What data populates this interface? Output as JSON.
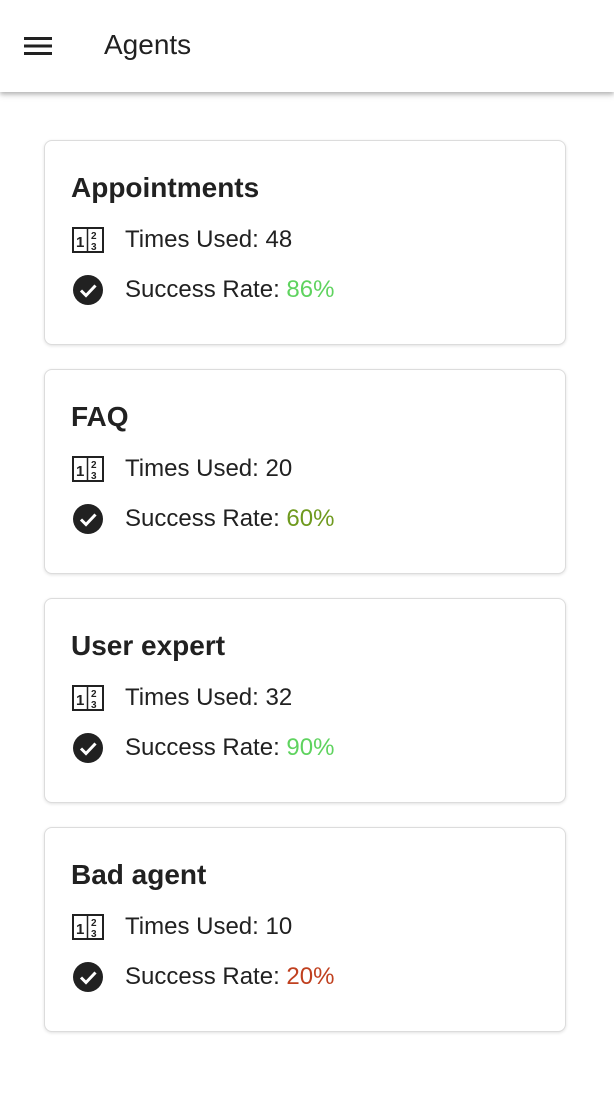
{
  "header": {
    "title": "Agents",
    "menu_icon": "menu-icon"
  },
  "labels": {
    "times_used": "Times Used: ",
    "success_rate": "Success Rate: "
  },
  "icons": {
    "usage": "numbers-icon",
    "success": "check-circle-icon"
  },
  "agents": [
    {
      "name": "Appointments",
      "times_used": "48",
      "success_rate": "86%",
      "rate_color": "#5fd35f"
    },
    {
      "name": "FAQ",
      "times_used": "20",
      "success_rate": "60%",
      "rate_color": "#6f9a1f"
    },
    {
      "name": "User expert",
      "times_used": "32",
      "success_rate": "90%",
      "rate_color": "#5fd35f"
    },
    {
      "name": "Bad agent",
      "times_used": "10",
      "success_rate": "20%",
      "rate_color": "#c0401f"
    }
  ]
}
